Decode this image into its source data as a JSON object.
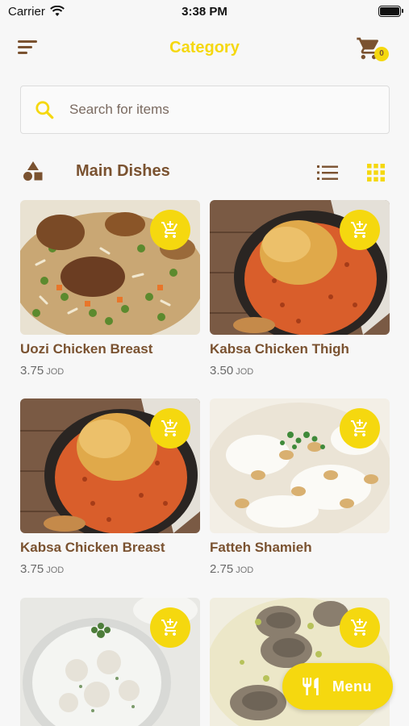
{
  "status_bar": {
    "carrier": "Carrier",
    "time": "3:38 PM"
  },
  "header": {
    "title": "Category",
    "cart_count": "0"
  },
  "search": {
    "placeholder": "Search for items",
    "value": ""
  },
  "section": {
    "title": "Main Dishes"
  },
  "products": [
    {
      "name": "Uozi Chicken Breast",
      "price": "3.75",
      "currency": "JOD",
      "icon": "add-to-cart-icon"
    },
    {
      "name": "Kabsa Chicken Thigh",
      "price": "3.50",
      "currency": "JOD",
      "icon": "add-to-cart-icon"
    },
    {
      "name": "Kabsa Chicken Breast",
      "price": "3.75",
      "currency": "JOD",
      "icon": "add-to-cart-icon"
    },
    {
      "name": "Fatteh Shamieh",
      "price": "2.75",
      "currency": "JOD",
      "icon": "add-to-cart-icon"
    },
    {
      "name": "",
      "price": "",
      "currency": "",
      "icon": "add-to-cart-icon"
    },
    {
      "name": "",
      "price": "",
      "currency": "",
      "icon": "add-to-cart-icon"
    }
  ],
  "fab": {
    "label": "Menu",
    "icon": "fork-knife-icon"
  },
  "colors": {
    "accent": "#f5d80f",
    "brown": "#7a5230",
    "background": "#f7f7f7"
  }
}
